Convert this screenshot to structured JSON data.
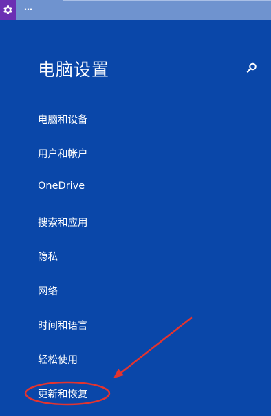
{
  "titlebar": {
    "menu_dots": "…",
    "icon": "gear-icon"
  },
  "header": {
    "title": "电脑设置",
    "search_icon": "search-icon"
  },
  "nav": {
    "items": [
      {
        "label": "电脑和设备"
      },
      {
        "label": "用户和帐户"
      },
      {
        "label": "OneDrive"
      },
      {
        "label": "搜索和应用"
      },
      {
        "label": "隐私"
      },
      {
        "label": "网络"
      },
      {
        "label": "时间和语言"
      },
      {
        "label": "轻松使用"
      },
      {
        "label": "更新和恢复"
      }
    ]
  },
  "annotation": {
    "highlighted_item": "更新和恢复",
    "color": "#e3342f"
  },
  "colors": {
    "background": "#0a47a9",
    "titlebar": "#6f93cf",
    "app_icon_bg": "#6b2fb3",
    "text": "#ffffff"
  }
}
